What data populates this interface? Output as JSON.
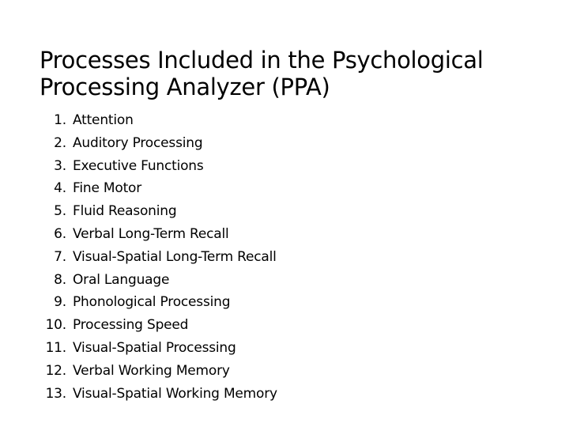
{
  "slide": {
    "title": "Processes Included in the Psychological Processing Analyzer (PPA)",
    "background_color": "#FFFFFF",
    "text_color": "#000000",
    "list": [
      {
        "number": "1.",
        "text": "Attention"
      },
      {
        "number": "2.",
        "text": "Auditory Processing"
      },
      {
        "number": "3.",
        "text": "Executive Functions"
      },
      {
        "number": "4.",
        "text": "Fine Motor"
      },
      {
        "number": "5.",
        "text": "Fluid Reasoning"
      },
      {
        "number": "6.",
        "text": "Verbal Long-Term Recall"
      },
      {
        "number": "7.",
        "text": "Visual-Spatial Long-Term Recall"
      },
      {
        "number": "8.",
        "text": "Oral Language"
      },
      {
        "number": "9.",
        "text": "Phonological Processing"
      },
      {
        "number": "10.",
        "text": "Processing Speed"
      },
      {
        "number": "11.",
        "text": "Visual-Spatial Processing"
      },
      {
        "number": "12.",
        "text": "Verbal Working Memory"
      },
      {
        "number": "13.",
        "text": "Visual-Spatial Working Memory"
      }
    ]
  }
}
